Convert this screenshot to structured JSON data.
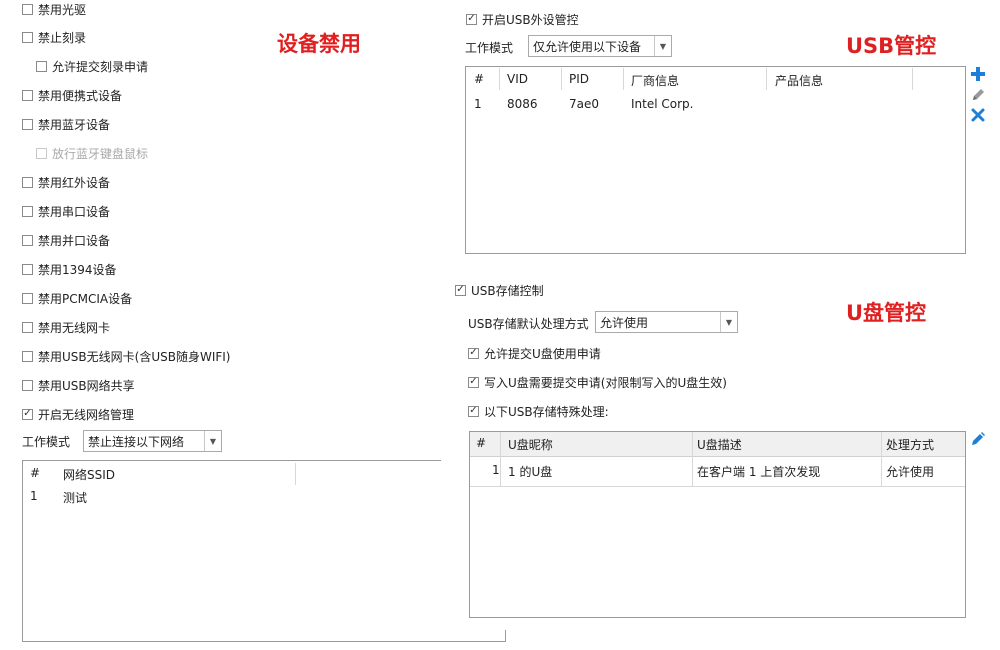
{
  "left": {
    "items": [
      {
        "label": "禁用光驱",
        "checked": false,
        "disabled": false
      },
      {
        "label": "禁止刻录",
        "checked": false,
        "disabled": false
      },
      {
        "label": "允许提交刻录申请",
        "checked": false,
        "disabled": false
      },
      {
        "label": "禁用便携式设备",
        "checked": false,
        "disabled": false
      },
      {
        "label": "禁用蓝牙设备",
        "checked": false,
        "disabled": false
      },
      {
        "label": "放行蓝牙键盘鼠标",
        "checked": false,
        "disabled": true
      },
      {
        "label": "禁用红外设备",
        "checked": false,
        "disabled": false
      },
      {
        "label": "禁用串口设备",
        "checked": false,
        "disabled": false
      },
      {
        "label": "禁用并口设备",
        "checked": false,
        "disabled": false
      },
      {
        "label": "禁用1394设备",
        "checked": false,
        "disabled": false
      },
      {
        "label": "禁用PCMCIA设备",
        "checked": false,
        "disabled": false
      },
      {
        "label": "禁用无线网卡",
        "checked": false,
        "disabled": false
      },
      {
        "label": "禁用USB无线网卡(含USB随身WIFI)",
        "checked": false,
        "disabled": false
      },
      {
        "label": "禁用USB网络共享",
        "checked": false,
        "disabled": false
      },
      {
        "label": "开启无线网络管理",
        "checked": true,
        "disabled": false
      }
    ],
    "work_mode_label": "工作模式",
    "work_mode_value": "禁止连接以下网络",
    "wifi_table": {
      "headers": [
        "#",
        "网络SSID"
      ],
      "rows": [
        [
          "1",
          "测试"
        ]
      ]
    }
  },
  "annotations": {
    "device_disable": "设备禁用",
    "usb_control": "USB管控",
    "udisk_control": "U盘管控"
  },
  "usb": {
    "enable_label": "开启USB外设管控",
    "enable_checked": true,
    "work_mode_label": "工作模式",
    "work_mode_value": "仅允许使用以下设备",
    "table": {
      "headers": [
        "#",
        "VID",
        "PID",
        "厂商信息",
        "产品信息"
      ],
      "rows": [
        [
          "1",
          "8086",
          "7ae0",
          "Intel Corp.",
          ""
        ]
      ]
    }
  },
  "storage": {
    "enable_label": "USB存储控制",
    "enable_checked": true,
    "default_label": "USB存储默认处理方式",
    "default_value": "允许使用",
    "allow_apply_label": "允许提交U盘使用申请",
    "allow_apply_checked": true,
    "write_apply_label": "写入U盘需要提交申请(对限制写入的U盘生效)",
    "write_apply_checked": true,
    "special_label": "以下USB存储特殊处理:",
    "special_checked": true,
    "table": {
      "headers": [
        "#",
        "U盘昵称",
        "U盘描述",
        "处理方式"
      ],
      "rows": [
        [
          "1",
          "1 的U盘",
          "在客户端 1 上首次发现",
          "允许使用"
        ]
      ]
    }
  },
  "icons": {
    "add": "plus-icon",
    "edit": "pencil-icon",
    "delete": "x-icon",
    "accent": "#1e7fd8",
    "annotation_color": "#e02020"
  }
}
